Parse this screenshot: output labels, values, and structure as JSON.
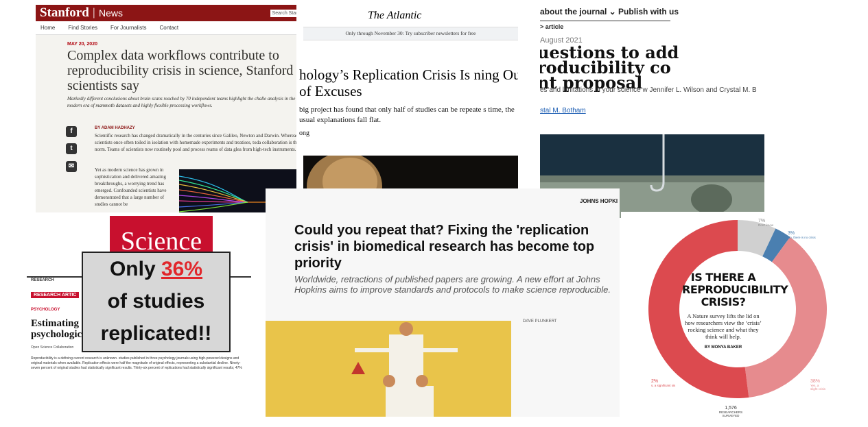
{
  "stanford": {
    "logo": "Stanford",
    "section": "News",
    "search_label": "Search Stanf",
    "nav": [
      "Home",
      "Find Stories",
      "For Journalists",
      "Contact"
    ],
    "date": "MAY 20, 2020",
    "headline": "Complex data workflows contribute to reproducibility crisis in science, Stanford scientists say",
    "dek": "Markedly different conclusions about brain scans reached by 70 independent teams highlight the challe analysis in the modern era of mammoth datasets and highly flexible processing workflows.",
    "byline": "BY ADAM HADHAZY",
    "body1": "Scientific research has changed dramatically in the centuries since Galileo, Newton and Darwin. Whereas scientists once often toiled in isolation with homemade experiments and treatises, toda collaboration is the norm. Teams of scientists now routinely pool and process reams of data glea from high-tech instruments.",
    "body2": "Yet as modern science has grown in sophistication and delivered amazing breakthroughs, a worrying trend has emerged. Confounded scientists have demonstrated that a large number of studies cannot be"
  },
  "atlantic": {
    "masthead": "The Atlantic",
    "promo": "Only through November 30: Try subscriber newsletters for free",
    "title": "hology’s Replication Crisis Is ning Out of Excuses",
    "subtitle": "big project has found that only half of studies can be repeate s time, the usual explanations fall flat.",
    "author": "ong"
  },
  "nature": {
    "topnav": "about the journal ⌄      Publish with us",
    "crumb": "> article",
    "date": "August 2021",
    "title_lines": [
      "uestions to add",
      "roducibility co",
      "nt proposal"
    ],
    "subtitle": "es and limitations in your science w Jennifer L. Wilson and Crystal M. B",
    "author_link": "stal M. Botham"
  },
  "hopkins": {
    "logo": "JOHNS HOPKI",
    "headline": "Could you repeat that? Fixing the 'replication crisis' in biomedical research has become top priority",
    "dek": "Worldwide, retractions of published papers are growing. A new effort at Johns Hopkins aims to improve standards and protocols to make science reproducible.",
    "credit": "DAVE PLUNKERT"
  },
  "science": {
    "logo": "Science",
    "kicker": "RESEARCH",
    "bar": "RESEARCH ARTIC",
    "category": "PSYCHOLOGY",
    "title": "Estimating psychologic",
    "author": "Open Science Collaboration",
    "body": "Reproducibility is a defining current research is unknown. studies published in three psychology journals using high-powered designs and original materials when available. Replication effects were half the magnitude of original effects, representing a substantial decline. Ninety-seven percent of original studies had statistically significant results. Thirty-six percent of replications had statistically significant results; 47%"
  },
  "callout": {
    "line1": "Only",
    "percent": "36%",
    "line2": "of studies",
    "line3": "replicated!!"
  },
  "donut": {
    "title": "IS THERE A REPRODUCIBILITY CRISIS?",
    "body": "A Nature survey lifts the lid on how researchers view the ‘crisis’ rocking science and what they think will help.",
    "byline": "BY MONYA BAKER",
    "total": "1,576",
    "total_label": "RESEARCHERS SURVEYED",
    "segments": [
      {
        "label": "7%",
        "note": "Don't know",
        "value": 7,
        "color": "#d0d0d0"
      },
      {
        "label": "3%",
        "note": "No, there is no crisis",
        "value": 3,
        "color": "#4a7fb0"
      },
      {
        "label": "38%",
        "note": "Yes, a slight crisis",
        "value": 38,
        "color": "#e68b8e"
      },
      {
        "label": "52%",
        "note": "Yes, a significant crisis",
        "value": 52,
        "color": "#dc4a4f"
      }
    ],
    "visible_labels": {
      "dk": "7%",
      "dk_note": "Don't know",
      "no": "3%",
      "no_note": "No, there is no crisis",
      "slight": "38%",
      "slight_note": "Yes, a slight crisis",
      "sig": "2%",
      "sig_note": "s, a significant sis"
    }
  },
  "partial_words": {
    "hopkins_right": "tes o r. The ng bia oducib t to b te-Ge on's re Writ emy ir can"
  }
}
